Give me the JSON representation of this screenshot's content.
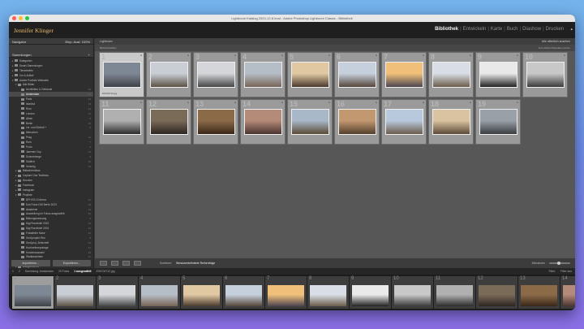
{
  "window": {
    "title": "Lightroom Katalog 2024-12-8.lrcat - Adobe Photoshop Lightroom Classic - Bibliothek"
  },
  "identity": {
    "name": "Jennifer Klinger",
    "panel_toggle": "▴"
  },
  "modules": [
    {
      "label": "Bibliothek",
      "active": true
    },
    {
      "label": "Entwickeln",
      "active": false
    },
    {
      "label": "Karte",
      "active": false
    },
    {
      "label": "Buch",
      "active": false
    },
    {
      "label": "Diashow",
      "active": false
    },
    {
      "label": "Drucken",
      "active": false
    }
  ],
  "navigator": {
    "title": "Navigator",
    "zoom": "Einp.  Ausf.  100%"
  },
  "catalog": {
    "title": "Sammlungen"
  },
  "tree": [
    {
      "label": "Kategorien",
      "count": "",
      "indent": 1,
      "tri": "▸"
    },
    {
      "label": "Smart-Sammlungen",
      "count": "",
      "indent": 1,
      "tri": "▸"
    },
    {
      "label": "Tierarbeiten",
      "count": "",
      "indent": 1,
      "tri": "▸"
    },
    {
      "label": "Vor & Artikel",
      "count": "",
      "indent": 1,
      "tri": "▸"
    },
    {
      "label": "Adobe Portfolio Webseite",
      "count": "",
      "indent": 1,
      "tri": "▾"
    },
    {
      "label": "Alle Bilder",
      "count": "",
      "indent": 2,
      "tri": "▾"
    },
    {
      "label": "Architektur & Gebäude",
      "count": "33",
      "indent": 3,
      "tri": ""
    },
    {
      "label": "Amsterdam",
      "count": "17",
      "indent": 3,
      "tri": "",
      "selected": true
    },
    {
      "label": "Paris",
      "count": "24",
      "indent": 3,
      "tri": ""
    },
    {
      "label": "Istanbul",
      "count": "19",
      "indent": 3,
      "tri": ""
    },
    {
      "label": "Rom",
      "count": "21",
      "indent": 3,
      "tri": ""
    },
    {
      "label": "London",
      "count": "12",
      "indent": 3,
      "tri": ""
    },
    {
      "label": "Athen",
      "count": "8",
      "indent": 3,
      "tri": ""
    },
    {
      "label": "Berlin",
      "count": "15",
      "indent": 3,
      "tri": ""
    },
    {
      "label": "Lie- und Südhof +",
      "count": "9",
      "indent": 3,
      "tri": ""
    },
    {
      "label": "Menschen",
      "count": "",
      "indent": 3,
      "tri": ""
    },
    {
      "label": "Prag",
      "count": "11",
      "indent": 3,
      "tri": ""
    },
    {
      "label": "Rom",
      "count": "7",
      "indent": 3,
      "tri": ""
    },
    {
      "label": "Porto",
      "count": "6",
      "indent": 3,
      "tri": ""
    },
    {
      "label": "Jammen Cup",
      "count": "14",
      "indent": 3,
      "tri": ""
    },
    {
      "label": "Schneeberge",
      "count": "5",
      "indent": 3,
      "tri": ""
    },
    {
      "label": "Südtirol",
      "count": "10",
      "indent": 3,
      "tri": ""
    },
    {
      "label": "Venedig",
      "count": "16",
      "indent": 3,
      "tri": ""
    },
    {
      "label": "Bildschirmfotos",
      "count": "",
      "indent": 2,
      "tri": "▸"
    },
    {
      "label": "Capture One Testfotos",
      "count": "",
      "indent": 2,
      "tri": "▸"
    },
    {
      "label": "Drucken",
      "count": "",
      "indent": 2,
      "tri": "▸"
    },
    {
      "label": "Facebook",
      "count": "",
      "indent": 2,
      "tri": "▸"
    },
    {
      "label": "Instagram",
      "count": "",
      "indent": 2,
      "tri": "▸"
    },
    {
      "label": "Projekte",
      "count": "",
      "indent": 2,
      "tri": "▾"
    },
    {
      "label": "DFH 09-10 Arena",
      "count": "22",
      "indent": 3,
      "tri": ""
    },
    {
      "label": "Dok Fotos DW Berlin 2023",
      "count": "18",
      "indent": 3,
      "tri": ""
    },
    {
      "label": "Akademie",
      "count": "13",
      "indent": 3,
      "tri": ""
    },
    {
      "label": "Ausstellung Im Fokus ausgewählt",
      "count": "40",
      "indent": 3,
      "tri": ""
    },
    {
      "label": "Bildungsmessung",
      "count": "9",
      "indent": 3,
      "tri": ""
    },
    {
      "label": "Digi Rundbrief 2023",
      "count": "12",
      "indent": 3,
      "tri": ""
    },
    {
      "label": "Digi Rundbrief 2024",
      "count": "16",
      "indent": 3,
      "tri": ""
    },
    {
      "label": "Fotoatelier Natur",
      "count": "24",
      "indent": 3,
      "tri": ""
    },
    {
      "label": "Großprojekt Film",
      "count": "8",
      "indent": 3,
      "tri": ""
    },
    {
      "label": "Großproj. Zeitschrift",
      "count": "31",
      "indent": 3,
      "tri": ""
    },
    {
      "label": "Hochzeitsreportage",
      "count": "27",
      "indent": 3,
      "tri": ""
    },
    {
      "label": "Kundenauswahl",
      "count": "19",
      "indent": 3,
      "tri": ""
    },
    {
      "label": "Stadtansichten",
      "count": "21",
      "indent": 3,
      "tri": ""
    },
    {
      "label": "Workshops",
      "count": "6",
      "indent": 3,
      "tri": ""
    },
    {
      "label": "Alltags-Abend",
      "count": "",
      "indent": 2,
      "tri": "▸"
    },
    {
      "label": "Blitz Drill",
      "count": "",
      "indent": 2,
      "tri": "▸"
    }
  ],
  "left_buttons": {
    "import": "Importieren...",
    "export": "Exportieren..."
  },
  "grid": {
    "header_left": "Lightroom",
    "header_right": "Alle offentlich ansehen",
    "filter_left": "Bibliotheksfilter:",
    "filter_right": "Text   Attribut   Metadaten   Keine",
    "cells": [
      {
        "num": "1",
        "cap": "DSC04712.jpg",
        "selected": true,
        "c1": "#7e8794",
        "c2": "#3f4248"
      },
      {
        "num": "2",
        "cap": "",
        "selected": false,
        "c1": "#c9cdd4",
        "c2": "#5c5246"
      },
      {
        "num": "3",
        "cap": "",
        "selected": false,
        "c1": "#d4d6d9",
        "c2": "#454545"
      },
      {
        "num": "4",
        "cap": "",
        "selected": false,
        "c1": "#b5bdc6",
        "c2": "#776455"
      },
      {
        "num": "5",
        "cap": "",
        "selected": false,
        "c1": "#e0c8a2",
        "c2": "#4a3a2e"
      },
      {
        "num": "6",
        "cap": "",
        "selected": false,
        "c1": "#c6d0dc",
        "c2": "#55453a"
      },
      {
        "num": "7",
        "cap": "",
        "selected": false,
        "c1": "#f0c07a",
        "c2": "#4c4450"
      },
      {
        "num": "8",
        "cap": "",
        "selected": false,
        "c1": "#d8dde6",
        "c2": "#6b5c4a"
      },
      {
        "num": "9",
        "cap": "",
        "selected": false,
        "c1": "#e9e9e9",
        "c2": "#222222"
      },
      {
        "num": "10",
        "cap": "",
        "selected": false,
        "c1": "#c8c8c8",
        "c2": "#3a3a3a"
      },
      {
        "num": "11",
        "cap": "",
        "selected": false,
        "c1": "#b0b0b0",
        "c2": "#2c2c2c"
      },
      {
        "num": "12",
        "cap": "",
        "selected": false,
        "c1": "#7a6a58",
        "c2": "#2e2622"
      },
      {
        "num": "13",
        "cap": "",
        "selected": false,
        "c1": "#8b6a48",
        "c2": "#3a2718"
      },
      {
        "num": "14",
        "cap": "",
        "selected": false,
        "c1": "#b48a78",
        "c2": "#4a3430"
      },
      {
        "num": "15",
        "cap": "",
        "selected": false,
        "c1": "#a9b8c9",
        "c2": "#5a4a36"
      },
      {
        "num": "16",
        "cap": "",
        "selected": false,
        "c1": "#c29870",
        "c2": "#53402c"
      },
      {
        "num": "17",
        "cap": "",
        "selected": false,
        "c1": "#b9c9dd",
        "c2": "#6a5b4c"
      },
      {
        "num": "18",
        "cap": "",
        "selected": false,
        "c1": "#d9c3a0",
        "c2": "#5c4a38"
      },
      {
        "num": "19",
        "cap": "",
        "selected": false,
        "c1": "#9aa0a8",
        "c2": "#3a3c40"
      }
    ]
  },
  "toolbar": {
    "sort_label": "Sortieren:",
    "sort_value": "Benutzerdefinierte Reihenfolge",
    "thumb_label": "Miniaturen"
  },
  "filmstrip": {
    "bar": [
      {
        "label": "1",
        "active": false
      },
      {
        "label": "2",
        "active": false
      },
      {
        "label": "Sammlung: Amsterdam",
        "active": false
      },
      {
        "label": "19 Fotos",
        "active": false
      },
      {
        "label": "1 ausgewählt",
        "active": true
      },
      {
        "label": "/DSC04712.jpg",
        "active": false
      }
    ],
    "filter_label": "Filter:",
    "filter_value": "Filter aus",
    "cells": [
      {
        "num": "1",
        "selected": true,
        "c1": "#7e8794",
        "c2": "#3f4248"
      },
      {
        "num": "2",
        "selected": false,
        "c1": "#c9cdd4",
        "c2": "#5c5246"
      },
      {
        "num": "3",
        "selected": false,
        "c1": "#d4d6d9",
        "c2": "#454545"
      },
      {
        "num": "4",
        "selected": false,
        "c1": "#b5bdc6",
        "c2": "#776455"
      },
      {
        "num": "5",
        "selected": false,
        "c1": "#e0c8a2",
        "c2": "#4a3a2e"
      },
      {
        "num": "6",
        "selected": false,
        "c1": "#c6d0dc",
        "c2": "#55453a"
      },
      {
        "num": "7",
        "selected": false,
        "c1": "#f0c07a",
        "c2": "#4c4450"
      },
      {
        "num": "8",
        "selected": false,
        "c1": "#d8dde6",
        "c2": "#6b5c4a"
      },
      {
        "num": "9",
        "selected": false,
        "c1": "#e9e9e9",
        "c2": "#222222"
      },
      {
        "num": "10",
        "selected": false,
        "c1": "#c8c8c8",
        "c2": "#3a3a3a"
      },
      {
        "num": "11",
        "selected": false,
        "c1": "#b0b0b0",
        "c2": "#2c2c2c"
      },
      {
        "num": "12",
        "selected": false,
        "c1": "#7a6a58",
        "c2": "#2e2622"
      },
      {
        "num": "13",
        "selected": false,
        "c1": "#8b6a48",
        "c2": "#3a2718"
      },
      {
        "num": "14",
        "selected": false,
        "c1": "#b48a78",
        "c2": "#4a3430"
      }
    ]
  },
  "colors": {
    "brand": "#e7b76a",
    "panel": "#2e2e2e",
    "grid_bg": "#575757",
    "filmstrip_bg": "#1c1c1c"
  }
}
